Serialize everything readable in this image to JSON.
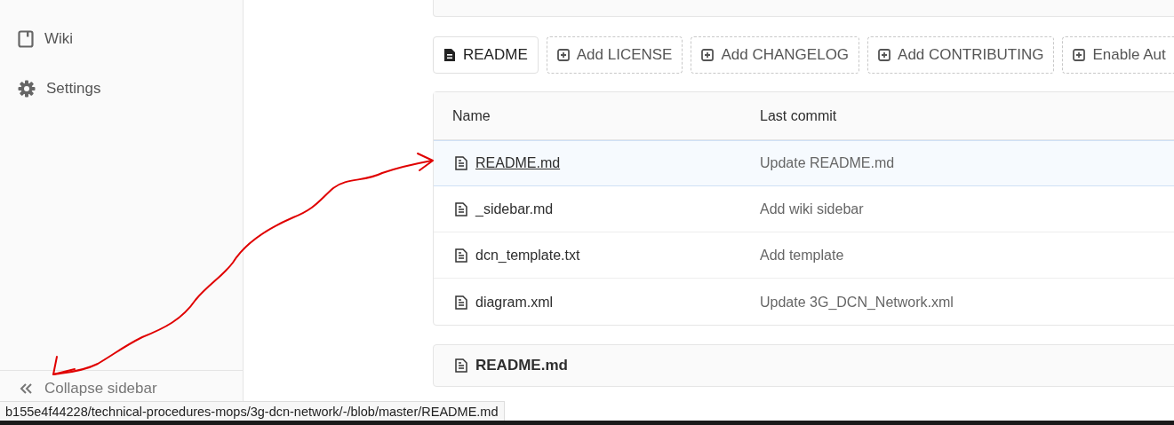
{
  "sidebar": {
    "items": [
      {
        "kind": "wiki",
        "label": "Wiki"
      },
      {
        "kind": "settings",
        "label": "Settings"
      }
    ],
    "collapse": {
      "label": "Collapse sidebar"
    }
  },
  "actions": [
    {
      "kind": "file",
      "label": "README"
    },
    {
      "kind": "add",
      "label": "Add LICENSE"
    },
    {
      "kind": "add",
      "label": "Add CHANGELOG"
    },
    {
      "kind": "add",
      "label": "Add CONTRIBUTING"
    },
    {
      "kind": "add",
      "label": "Enable Aut"
    }
  ],
  "table": {
    "columns": [
      "Name",
      "Last commit"
    ],
    "rows": [
      {
        "name": "README.md",
        "commit": "Update README.md",
        "highlighted": true
      },
      {
        "name": "_sidebar.md",
        "commit": "Add wiki sidebar",
        "highlighted": false
      },
      {
        "name": "dcn_template.txt",
        "commit": "Add template",
        "highlighted": false
      },
      {
        "name": "diagram.xml",
        "commit": "Update 3G_DCN_Network.xml",
        "highlighted": false
      }
    ]
  },
  "readme": {
    "title": "README.md"
  },
  "status_bar": {
    "url": "b155e4f44228/technical-procedures-mops/3g-dcn-network/-/blob/master/README.md"
  }
}
